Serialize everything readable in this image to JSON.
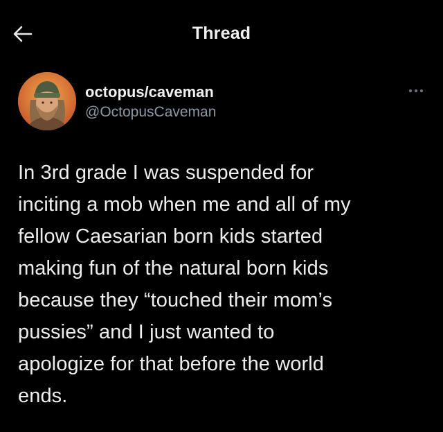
{
  "header": {
    "back_icon": "arrow-left-icon",
    "title": "Thread"
  },
  "author": {
    "avatar_icon": "profile-photo",
    "display_name": "octopus/caveman",
    "handle": "@OctopusCaveman",
    "more_icon": "more-dots-icon"
  },
  "tweet": {
    "lines": [
      "In 3rd grade I was suspended for",
      "inciting a mob when me and all of my",
      "fellow Caesarian born kids started",
      "making fun of the natural born kids",
      "because they “touched their mom’s",
      "pussies” and I just wanted to",
      "apologize for that before the world",
      "ends."
    ]
  },
  "colors": {
    "background": "#000000",
    "text": "#e7e9ea",
    "secondary_text": "#8b98a5"
  }
}
